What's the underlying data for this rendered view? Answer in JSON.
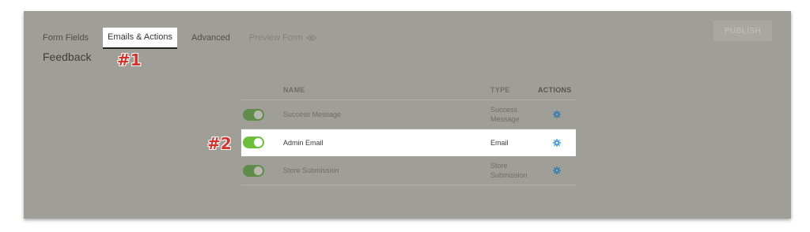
{
  "tabs": {
    "form_fields": "Form Fields",
    "emails_actions": "Emails & Actions",
    "advanced": "Advanced",
    "preview": "Preview Form"
  },
  "form_title": "Feedback",
  "publish_label": "PUBLISH",
  "annotations": {
    "first": "#1",
    "second": "#2"
  },
  "table": {
    "headers": {
      "name": "NAME",
      "type": "TYPE",
      "actions": "ACTIONS"
    },
    "rows": [
      {
        "name": "Success Message",
        "type_line1": "Success",
        "type_line2": "Message",
        "enabled": true
      },
      {
        "name": "Admin Email",
        "type_line1": "Email",
        "type_line2": "",
        "enabled": true
      },
      {
        "name": "Store Submission",
        "type_line1": "Store",
        "type_line2": "Submission",
        "enabled": true
      }
    ]
  },
  "colors": {
    "accent_gear": "#4aa3df",
    "toggle_on": "#6bbf3b",
    "annotation": "#d8332a"
  },
  "icons": {
    "preview": "eye-icon",
    "action": "gear-icon"
  }
}
